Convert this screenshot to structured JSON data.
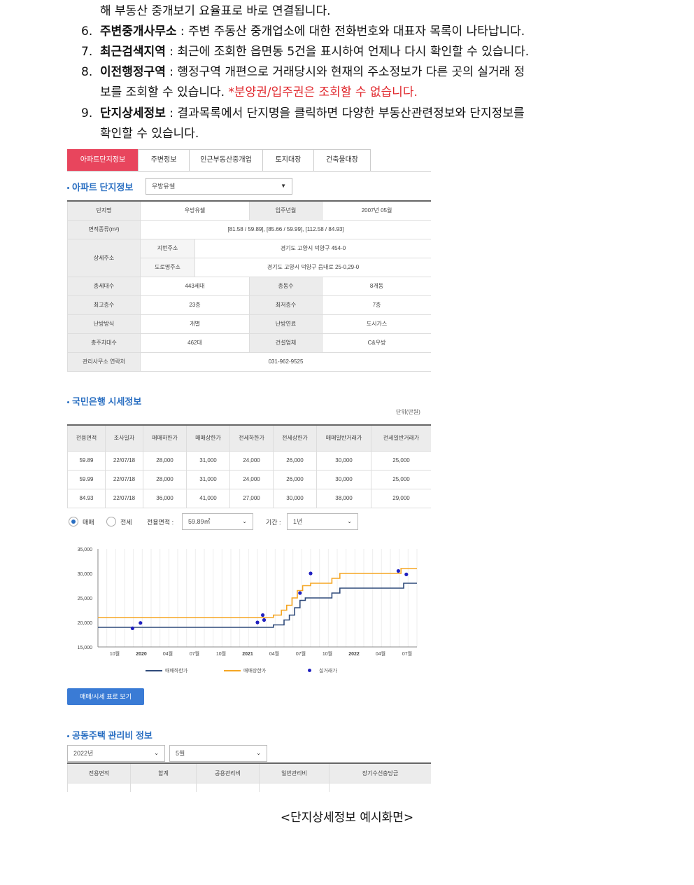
{
  "doc": {
    "line0": "해 부동산 중개보기 요율표로 바로 연결됩니다.",
    "items": [
      {
        "num": "6.",
        "term": "주변중개사무소",
        "text": " : 주변 주동산 중개업소에 대한 전화번호와 대표자 목록이 나타납니다."
      },
      {
        "num": "7.",
        "term": "최근검색지역",
        "text": " : 최근에 조회한 읍면동 5건을 표시하여 언제나 다시 확인할 수 있습니다."
      },
      {
        "num": "8.",
        "term": "이전행정구역",
        "text": " : 행정구역 개편으로 거래당시와 현재의 주소정보가 다른 곳의 실거래 정",
        "cont": "보를 조회할 수 있습니다. ",
        "cont_red": "*분양권/입주권은 조회할 수 없습니다."
      },
      {
        "num": "9.",
        "term": "단지상세정보",
        "text": " : 결과목록에서 단지명을 클릭하면 다양한 부동산관련정보와 단지정보를",
        "cont": "확인할 수 있습니다."
      }
    ],
    "caption": "<단지상세정보 예시화면>"
  },
  "shot": {
    "tabs": [
      "아파트단지정보",
      "주변정보",
      "인근부동산중개업",
      "토지대장",
      "건축물대장"
    ],
    "section1": "아파트 단지정보",
    "complex_select": "우방유쉘",
    "info": {
      "name_label": "단지명",
      "name": "우방유쉘",
      "move_label": "입주년월",
      "move": "2007년 05월",
      "area_label": "면적종류(m²)",
      "area": "[81.58 / 59.89], [85.66 / 59.99], [112.58 / 84.93]",
      "addr_label": "상세주소",
      "jibun_label": "지번주소",
      "jibun": "경기도 고양시 덕양구 454-0",
      "road_label": "도로명주소",
      "road": "경기도 고양시 덕양구 읍내로 25-0,29-0",
      "households_label": "총세대수",
      "households": "443세대",
      "buildings_label": "총동수",
      "buildings": "8개동",
      "max_floor_label": "최고층수",
      "max_floor": "23층",
      "min_floor_label": "최저층수",
      "min_floor": "7층",
      "heating_label": "난방방식",
      "heating": "개별",
      "fuel_label": "난방연료",
      "fuel": "도시가스",
      "parking_label": "총주차대수",
      "parking": "462대",
      "builder_label": "건설업체",
      "builder": "C&우방",
      "office_label": "관리사무소 연락처",
      "office": "031-962-9525"
    },
    "section2": "국민은행 시세정보",
    "unit": "단위(만원)",
    "kb_headers": [
      "전용면적",
      "조사일자",
      "매매하한가",
      "매매상한가",
      "전세하한가",
      "전세상한가",
      "매매일반거래가",
      "전세일반거래가"
    ],
    "kb_rows": [
      [
        "59.89",
        "22/07/18",
        "28,000",
        "31,000",
        "24,000",
        "26,000",
        "30,000",
        "25,000"
      ],
      [
        "59.99",
        "22/07/18",
        "28,000",
        "31,000",
        "24,000",
        "26,000",
        "30,000",
        "25,000"
      ],
      [
        "84.93",
        "22/07/18",
        "36,000",
        "41,000",
        "27,000",
        "30,000",
        "38,000",
        "29,000"
      ]
    ],
    "filter": {
      "sale": "매매",
      "jeonse": "전세",
      "area_label": "전용면적 :",
      "area_value": "59.89㎡",
      "period_label": "기간 :",
      "period_value": "1년"
    },
    "button": "매매/시세 표로 보기",
    "section3": "공동주택 관리비 정보",
    "year_select": "2022년",
    "month_select": "5월",
    "mgmt_headers": [
      "전용면적",
      "합계",
      "공용관리비",
      "일반관리비",
      "장기수선충당금"
    ]
  },
  "chart_data": {
    "type": "line",
    "x_ticks": [
      "10월",
      "2020",
      "04월",
      "07월",
      "10월",
      "2021",
      "04월",
      "07월",
      "10월",
      "2022",
      "04월",
      "07월"
    ],
    "y_ticks": [
      "35,000",
      "30,000",
      "25,000",
      "20,000",
      "15,000"
    ],
    "ylim": [
      15000,
      35000
    ],
    "series": [
      {
        "name": "매매하한가",
        "color": "#2f4a7a",
        "points": [
          [
            0,
            19000
          ],
          [
            6.3,
            19000
          ],
          [
            6.6,
            19500
          ],
          [
            7.0,
            20500
          ],
          [
            7.2,
            21500
          ],
          [
            7.4,
            23000
          ],
          [
            7.6,
            24500
          ],
          [
            7.8,
            25000
          ],
          [
            8.7,
            25000
          ],
          [
            8.8,
            26000
          ],
          [
            9.0,
            26000
          ],
          [
            9.1,
            27000
          ],
          [
            11.4,
            27000
          ],
          [
            11.5,
            28000
          ],
          [
            12,
            28000
          ]
        ]
      },
      {
        "name": "매매상한가",
        "color": "#f5a623",
        "points": [
          [
            0,
            21000
          ],
          [
            6.3,
            21000
          ],
          [
            6.6,
            21500
          ],
          [
            6.9,
            22500
          ],
          [
            7.1,
            23500
          ],
          [
            7.3,
            25000
          ],
          [
            7.5,
            26500
          ],
          [
            7.7,
            27500
          ],
          [
            8.0,
            28000
          ],
          [
            8.6,
            28000
          ],
          [
            8.8,
            29000
          ],
          [
            9.1,
            30000
          ],
          [
            11.3,
            30000
          ],
          [
            11.4,
            31000
          ],
          [
            12,
            31000
          ]
        ]
      }
    ],
    "scatter": {
      "name": "실거래가",
      "color": "#2020c0",
      "points": [
        [
          1.3,
          18800
        ],
        [
          1.6,
          19900
        ],
        [
          6.0,
          20000
        ],
        [
          6.2,
          21500
        ],
        [
          6.25,
          20500
        ],
        [
          7.6,
          26000
        ],
        [
          8.0,
          30000
        ],
        [
          11.3,
          30500
        ],
        [
          11.6,
          29800
        ]
      ]
    }
  },
  "colors": {
    "accent": "#e8455d",
    "blue": "#2a6fc2"
  }
}
